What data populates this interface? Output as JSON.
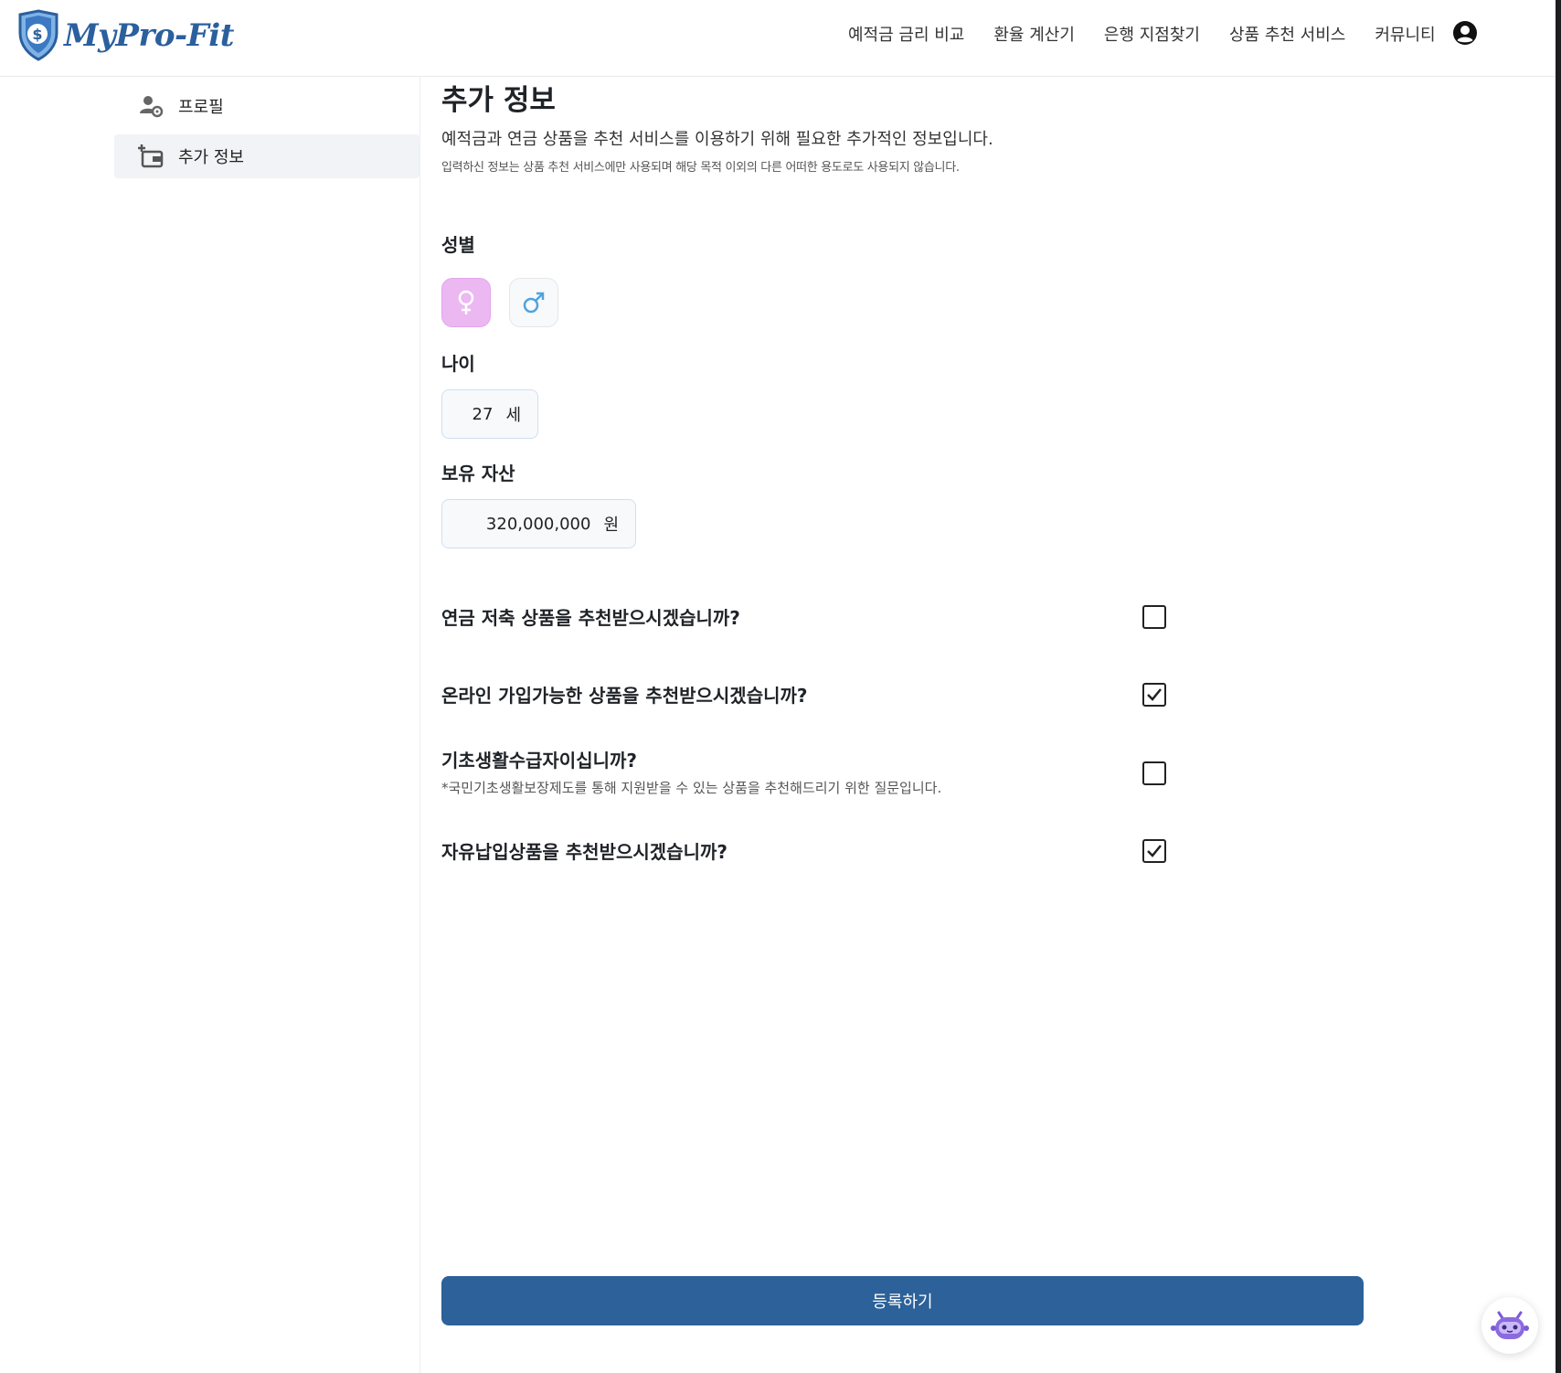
{
  "app": {
    "logo_text": "MyPro-Fit",
    "accent_color": "#2c6199"
  },
  "nav": {
    "items": [
      "예적금 금리 비교",
      "환율 계산기",
      "은행 지점찾기",
      "상품 추천 서비스",
      "커뮤니티"
    ],
    "user_icon": "user-circle-icon"
  },
  "sidebar": {
    "items": [
      {
        "label": "프로필",
        "icon": "user-gear-icon",
        "active": false
      },
      {
        "label": "추가 정보",
        "icon": "wallet-add-icon",
        "active": true
      }
    ]
  },
  "page": {
    "title": "추가 정보",
    "description": "예적금과 연금 상품을 추천 서비스를 이용하기 위해 필요한 추가적인 정보입니다.",
    "sub_description": "입력하신 정보는 상품 추천 서비스에만 사용되며 해당 목적 이외의 다른 어떠한 용도로도 사용되지 않습니다."
  },
  "form": {
    "gender_label": "성별",
    "gender_selected": "female",
    "age_label": "나이",
    "age_value": "27",
    "age_unit": "세",
    "asset_label": "보유 자산",
    "asset_value": "320,000,000",
    "asset_unit": "원",
    "questions": [
      {
        "label": "연금 저축 상품을 추천받으시겠습니까?",
        "note": "",
        "checked": false
      },
      {
        "label": "온라인 가입가능한 상품을 추천받으시겠습니까?",
        "note": "",
        "checked": true
      },
      {
        "label": "기초생활수급자이십니까?",
        "note": "*국민기초생활보장제도를 통해 지원받을 수 있는 상품을 추천해드리기 위한 질문입니다.",
        "checked": false
      },
      {
        "label": "자유납입상품을 추천받으시겠습니까?",
        "note": "",
        "checked": true
      }
    ],
    "submit_label": "등록하기"
  },
  "chatbot": {
    "icon": "robot-chat-icon"
  }
}
